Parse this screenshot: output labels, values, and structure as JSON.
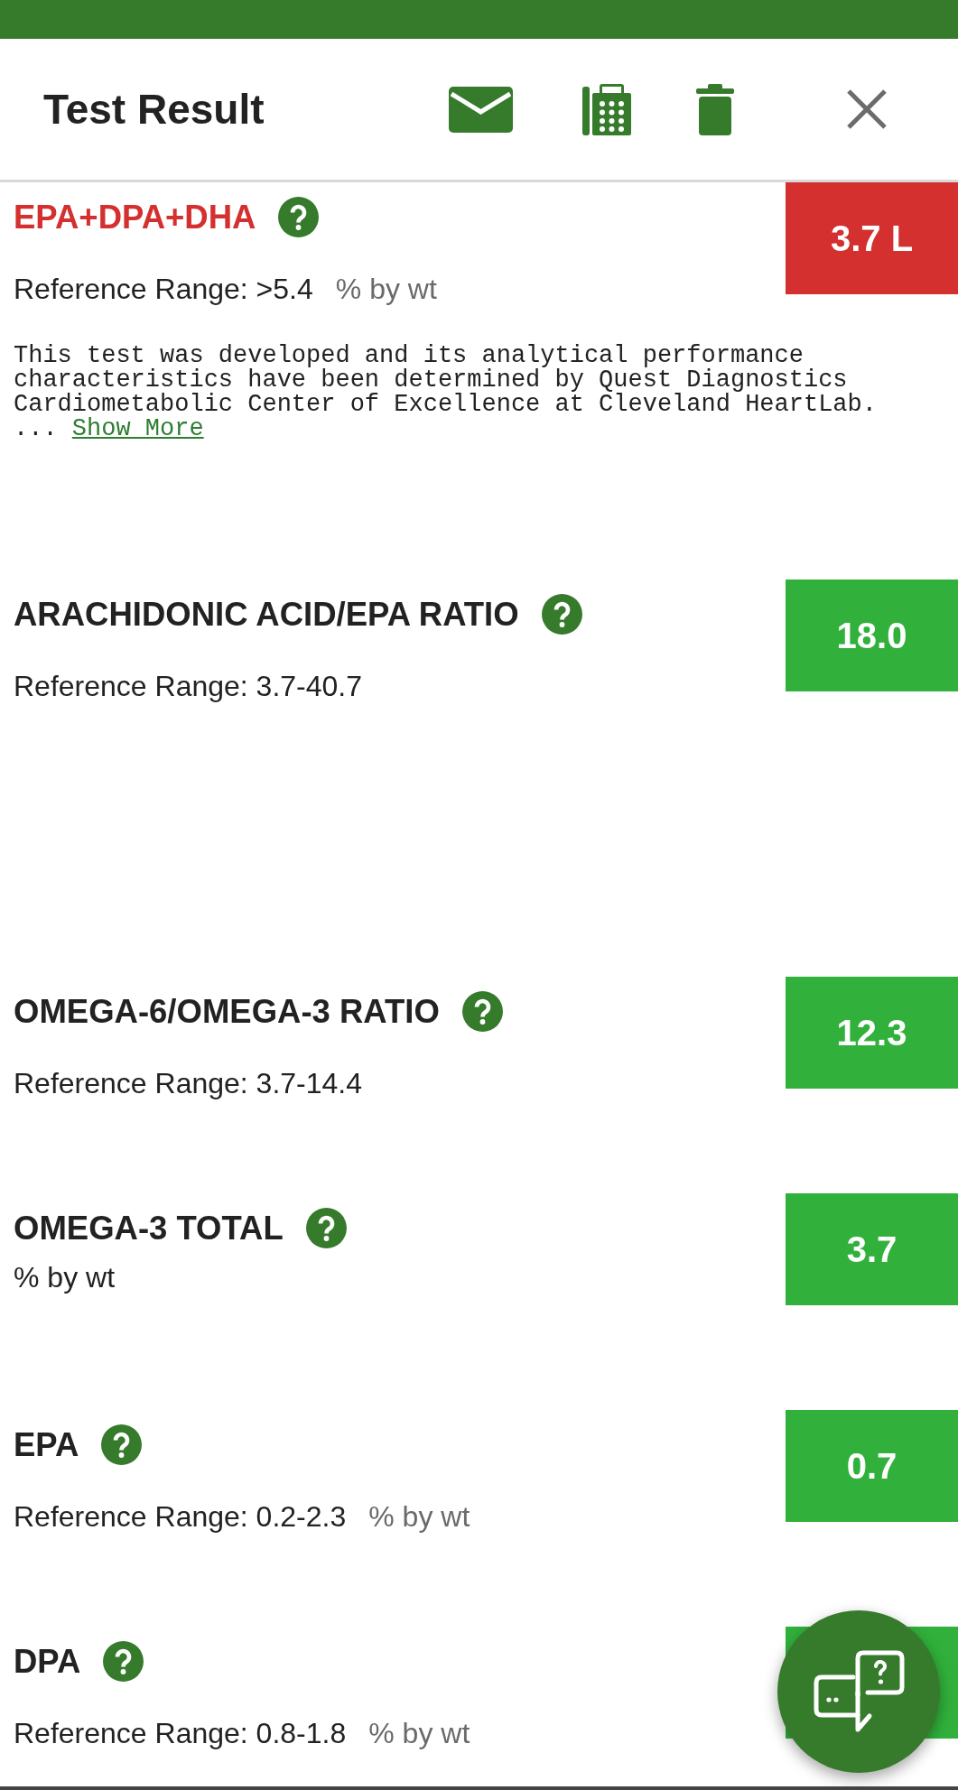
{
  "header": {
    "title": "Test Result"
  },
  "results": [
    {
      "name": "EPA+DPA+DHA",
      "abnormal": true,
      "value": "3.7 L",
      "reference_range": "Reference Range: >5.4",
      "unit": "% by wt",
      "note": "This test was developed and its analytical performance characteristics have been determined by Quest Diagnostics Cardiometabolic Center of Excellence at Cleveland HeartLab. ...",
      "show_more": "Show More"
    },
    {
      "name": "ARACHIDONIC ACID/EPA RATIO",
      "abnormal": false,
      "value": "18.0",
      "reference_range": "Reference Range: 3.7-40.7"
    },
    {
      "name": "OMEGA-6/OMEGA-3 RATIO",
      "abnormal": false,
      "value": "12.3",
      "reference_range": "Reference Range: 3.7-14.4"
    },
    {
      "name": "OMEGA-3 TOTAL",
      "abnormal": false,
      "value": "3.7",
      "unit": "% by wt"
    },
    {
      "name": "EPA",
      "abnormal": false,
      "value": "0.7",
      "reference_range": "Reference Range: 0.2-2.3",
      "unit": "% by wt"
    },
    {
      "name": "DPA",
      "abnormal": false,
      "reference_range": "Reference Range: 0.8-1.8",
      "unit": "% by wt"
    }
  ]
}
